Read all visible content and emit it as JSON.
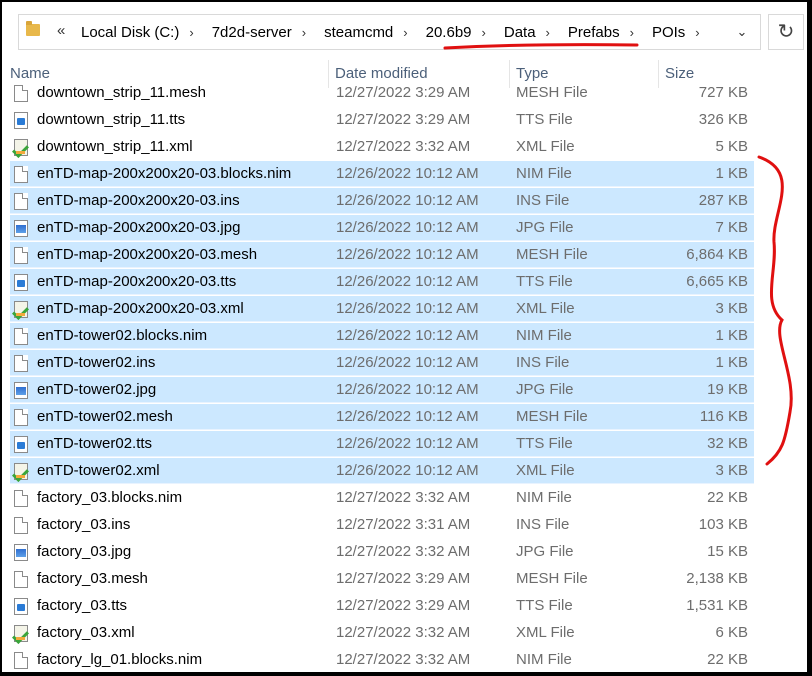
{
  "address_bar": {
    "overflow": "«",
    "crumbs": [
      "Local Disk (C:)",
      "7d2d-server",
      "steamcmd",
      "20.6b9",
      "Data",
      "Prefabs",
      "POIs"
    ],
    "separator": "›",
    "dropdown": "⌄",
    "refresh": "↻"
  },
  "columns": {
    "name": "Name",
    "date": "Date modified",
    "type": "Type",
    "size": "Size"
  },
  "files": [
    {
      "name": "downtown_strip_11.mesh",
      "date": "12/27/2022 3:29 AM",
      "type": "MESH File",
      "size": "727 KB",
      "icon": "doc",
      "selected": false
    },
    {
      "name": "downtown_strip_11.tts",
      "date": "12/27/2022 3:29 AM",
      "type": "TTS File",
      "size": "326 KB",
      "icon": "tts",
      "selected": false
    },
    {
      "name": "downtown_strip_11.xml",
      "date": "12/27/2022 3:32 AM",
      "type": "XML File",
      "size": "5 KB",
      "icon": "xml",
      "selected": false
    },
    {
      "name": "enTD-map-200x200x20-03.blocks.nim",
      "date": "12/26/2022 10:12 AM",
      "type": "NIM File",
      "size": "1 KB",
      "icon": "doc",
      "selected": true
    },
    {
      "name": "enTD-map-200x200x20-03.ins",
      "date": "12/26/2022 10:12 AM",
      "type": "INS File",
      "size": "287 KB",
      "icon": "doc",
      "selected": true
    },
    {
      "name": "enTD-map-200x200x20-03.jpg",
      "date": "12/26/2022 10:12 AM",
      "type": "JPG File",
      "size": "7 KB",
      "icon": "img",
      "selected": true
    },
    {
      "name": "enTD-map-200x200x20-03.mesh",
      "date": "12/26/2022 10:12 AM",
      "type": "MESH File",
      "size": "6,864 KB",
      "icon": "doc",
      "selected": true
    },
    {
      "name": "enTD-map-200x200x20-03.tts",
      "date": "12/26/2022 10:12 AM",
      "type": "TTS File",
      "size": "6,665 KB",
      "icon": "tts",
      "selected": true
    },
    {
      "name": "enTD-map-200x200x20-03.xml",
      "date": "12/26/2022 10:12 AM",
      "type": "XML File",
      "size": "3 KB",
      "icon": "xml",
      "selected": true
    },
    {
      "name": "enTD-tower02.blocks.nim",
      "date": "12/26/2022 10:12 AM",
      "type": "NIM File",
      "size": "1 KB",
      "icon": "doc",
      "selected": true
    },
    {
      "name": "enTD-tower02.ins",
      "date": "12/26/2022 10:12 AM",
      "type": "INS File",
      "size": "1 KB",
      "icon": "doc",
      "selected": true
    },
    {
      "name": "enTD-tower02.jpg",
      "date": "12/26/2022 10:12 AM",
      "type": "JPG File",
      "size": "19 KB",
      "icon": "img",
      "selected": true
    },
    {
      "name": "enTD-tower02.mesh",
      "date": "12/26/2022 10:12 AM",
      "type": "MESH File",
      "size": "116 KB",
      "icon": "doc",
      "selected": true
    },
    {
      "name": "enTD-tower02.tts",
      "date": "12/26/2022 10:12 AM",
      "type": "TTS File",
      "size": "32 KB",
      "icon": "tts",
      "selected": true
    },
    {
      "name": "enTD-tower02.xml",
      "date": "12/26/2022 10:12 AM",
      "type": "XML File",
      "size": "3 KB",
      "icon": "xml",
      "selected": true
    },
    {
      "name": "factory_03.blocks.nim",
      "date": "12/27/2022 3:32 AM",
      "type": "NIM File",
      "size": "22 KB",
      "icon": "doc",
      "selected": false
    },
    {
      "name": "factory_03.ins",
      "date": "12/27/2022 3:31 AM",
      "type": "INS File",
      "size": "103 KB",
      "icon": "doc",
      "selected": false
    },
    {
      "name": "factory_03.jpg",
      "date": "12/27/2022 3:32 AM",
      "type": "JPG File",
      "size": "15 KB",
      "icon": "img",
      "selected": false
    },
    {
      "name": "factory_03.mesh",
      "date": "12/27/2022 3:29 AM",
      "type": "MESH File",
      "size": "2,138 KB",
      "icon": "doc",
      "selected": false
    },
    {
      "name": "factory_03.tts",
      "date": "12/27/2022 3:29 AM",
      "type": "TTS File",
      "size": "1,531 KB",
      "icon": "tts",
      "selected": false
    },
    {
      "name": "factory_03.xml",
      "date": "12/27/2022 3:32 AM",
      "type": "XML File",
      "size": "6 KB",
      "icon": "xml",
      "selected": false
    },
    {
      "name": "factory_lg_01.blocks.nim",
      "date": "12/27/2022 3:32 AM",
      "type": "NIM File",
      "size": "22 KB",
      "icon": "doc",
      "selected": false
    }
  ],
  "colors": {
    "selection": "#cce8ff",
    "annotation": "#e01010",
    "header_text": "#4c607a"
  }
}
